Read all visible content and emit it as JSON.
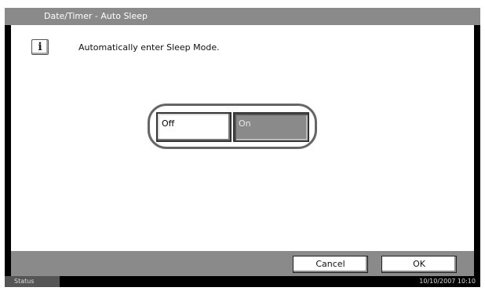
{
  "window": {
    "title": "Date/Timer - Auto Sleep"
  },
  "content": {
    "info_icon": "i",
    "message": "Automatically enter Sleep Mode."
  },
  "options": {
    "off_label": "Off",
    "on_label": "On",
    "selected": "On"
  },
  "actions": {
    "cancel_label": "Cancel",
    "ok_label": "OK"
  },
  "status_bar": {
    "status_label": "Status",
    "datetime": "10/10/2007  10:10"
  },
  "colors": {
    "panel_gray": "#8a8a8a",
    "screen_black": "#000000",
    "selected_button": "#8a8a8a"
  }
}
